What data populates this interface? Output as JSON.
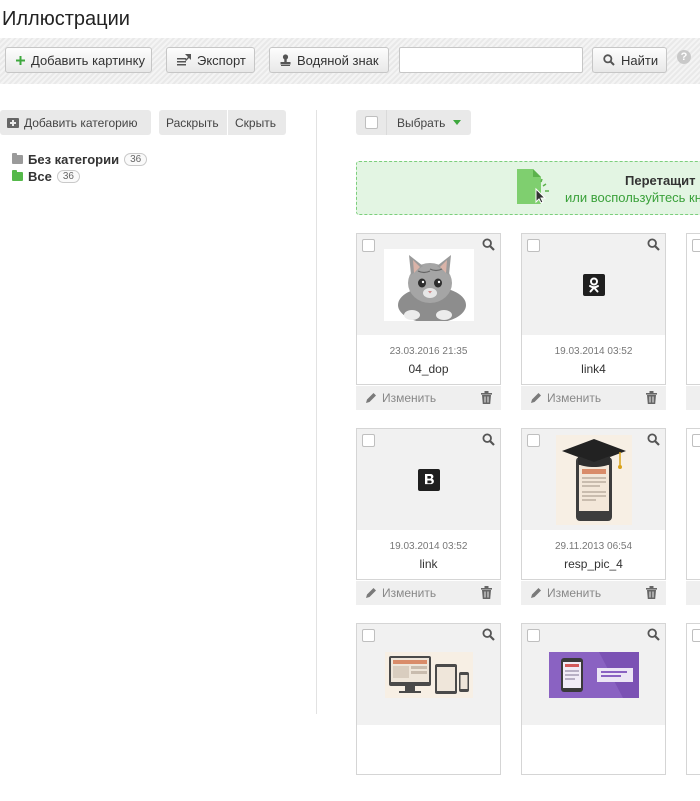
{
  "page": {
    "title": "Иллюстрации"
  },
  "toolbar": {
    "add_image": "Добавить картинку",
    "export": "Экспорт",
    "watermark": "Водяной знак",
    "search_value": "",
    "search_button": "Найти",
    "help": "?"
  },
  "left": {
    "add_category": "Добавить категорию",
    "expand": "Раскрыть",
    "collapse": "Скрыть",
    "categories": [
      {
        "label": "Без категории",
        "count": "36",
        "color": "#9a9a9a"
      },
      {
        "label": "Все",
        "count": "36",
        "color": "#55b94a"
      }
    ]
  },
  "right": {
    "select_label": "Выбрать",
    "dropzone": {
      "title": "Перетащит",
      "subtitle": "или воспользуйтесь кн"
    },
    "edit_label": "Изменить",
    "images": [
      {
        "date": "23.03.2016 21:35",
        "name": "04_dop",
        "thumb": "kitten"
      },
      {
        "date": "19.03.2014 03:52",
        "name": "link4",
        "thumb": "ok-logo"
      },
      {
        "date": "19.03.2014 03:52",
        "name": "link",
        "thumb": "vk-logo"
      },
      {
        "date": "29.11.2013 06:54",
        "name": "resp_pic_4",
        "thumb": "graduation-phone"
      },
      {
        "date": "",
        "name": "",
        "thumb": "devices"
      },
      {
        "date": "",
        "name": "",
        "thumb": "purple-banner"
      }
    ]
  },
  "colors": {
    "accent_green": "#3ea83e",
    "dropzone_bg": "#e3f5e3"
  }
}
